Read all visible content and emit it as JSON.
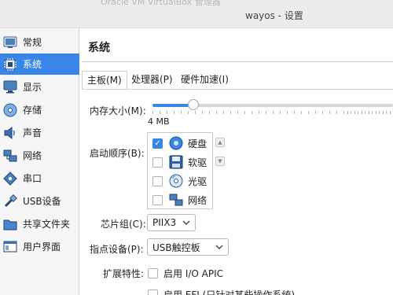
{
  "window": {
    "background_title": "Oracle VM VirtualBox 管理器",
    "title": "wayos - 设置"
  },
  "sidebar": {
    "items": [
      {
        "label": "常规",
        "icon": "general-icon",
        "selected": false
      },
      {
        "label": "系统",
        "icon": "system-chip-icon",
        "selected": true
      },
      {
        "label": "显示",
        "icon": "monitor-icon",
        "selected": false
      },
      {
        "label": "存储",
        "icon": "storage-disc-icon",
        "selected": false
      },
      {
        "label": "声音",
        "icon": "speaker-icon",
        "selected": false
      },
      {
        "label": "网络",
        "icon": "network-icon",
        "selected": false
      },
      {
        "label": "串口",
        "icon": "serial-port-icon",
        "selected": false
      },
      {
        "label": "USB设备",
        "icon": "usb-icon",
        "selected": false
      },
      {
        "label": "共享文件夹",
        "icon": "folder-icon",
        "selected": false
      },
      {
        "label": "用户界面",
        "icon": "user-interface-icon",
        "selected": false
      }
    ]
  },
  "page": {
    "title": "系统"
  },
  "tabs": [
    {
      "label": "主板(M)",
      "active": true
    },
    {
      "label": "处理器(P)",
      "active": false
    },
    {
      "label": "硬件加速(I)",
      "active": false
    }
  ],
  "memory": {
    "label": "内存大小(M):",
    "min_label": "4 MB",
    "slider_fraction": 0.17
  },
  "boot_order": {
    "label": "启动顺序(B):",
    "items": [
      {
        "label": "硬盘",
        "checked": true,
        "icon": "hard-disk-icon"
      },
      {
        "label": "软驱",
        "checked": false,
        "icon": "floppy-icon"
      },
      {
        "label": "光驱",
        "checked": false,
        "icon": "optical-disc-icon"
      },
      {
        "label": "网络",
        "checked": false,
        "icon": "network-icon"
      }
    ]
  },
  "chipset": {
    "label": "芯片组(C):",
    "value": "PIIX3"
  },
  "pointing_device": {
    "label": "指点设备(P):",
    "value": "USB触控板"
  },
  "extended": {
    "label": "扩展特性:",
    "options": [
      {
        "label": "启用 I/O APIC",
        "checked": false
      },
      {
        "label": "启用 EFI (只针对某些操作系统)",
        "checked": false
      }
    ]
  },
  "colors": {
    "accent": "#3a86e8",
    "sidebar_bg": "#f6f6f6",
    "titlebar_bg": "#ececec"
  }
}
